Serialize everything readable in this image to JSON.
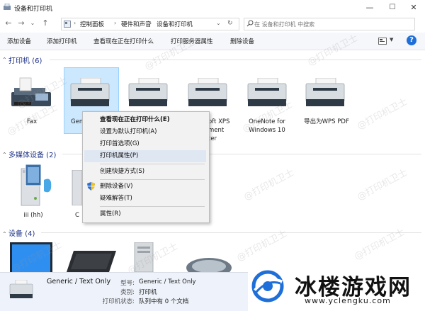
{
  "window": {
    "title": "设备和打印机",
    "min": "—",
    "max": "☐",
    "close": "✕"
  },
  "address": {
    "crumbs": [
      "控制面板",
      "硬件和声音",
      "设备和打印机"
    ]
  },
  "search": {
    "placeholder": "在 设备和打印机 中搜索"
  },
  "toolbar": {
    "items": [
      "添加设备",
      "添加打印机",
      "查看现在正在打印什么",
      "打印服务器属性",
      "删除设备"
    ]
  },
  "groups": {
    "printers": {
      "header": "打印机 (6)",
      "items": [
        "Fax",
        "Generic",
        "Microsoft XPS Document Writer",
        "",
        "OneNote for Windows 10",
        "导出为WPS PDF"
      ]
    },
    "multimedia": {
      "header": "多媒体设备 (2)",
      "items": [
        "iii (hh)",
        "C"
      ]
    },
    "devices": {
      "header": "设备 (4)"
    }
  },
  "printer_labels": {
    "fax": "Fax",
    "generic": "Gen",
    "xps_line1": "oft XPS",
    "xps_line2": "ment",
    "xps_line3": "ter",
    "onenote_line1": "OneNote for",
    "onenote_line2": "Windows 10",
    "wps": "导出为WPS PDF"
  },
  "multimedia_labels": {
    "a": "iii (hh)",
    "b": "C"
  },
  "context_menu": {
    "items": [
      "查看现在正在打印什么(E)",
      "设置为默认打印机(A)",
      "打印首选项(G)",
      "打印机属性(P)",
      "创建快捷方式(S)",
      "删除设备(V)",
      "疑难解答(T)",
      "属性(R)"
    ]
  },
  "details": {
    "name": "Generic / Text Only",
    "model_label": "型号:",
    "model_value": "Generic / Text Only",
    "category_label": "类别:",
    "category_value": "打印机",
    "status_label": "打印机状态:",
    "status_value": "队列中有 0 个文档"
  },
  "watermark": "@打印机卫士",
  "logo": {
    "text": "冰楼游戏网",
    "url": "www.yclengku.com"
  },
  "colors": {
    "accent": "#1e3287",
    "selection": "#cce8ff",
    "logo_blue": "#1e6fd9"
  }
}
